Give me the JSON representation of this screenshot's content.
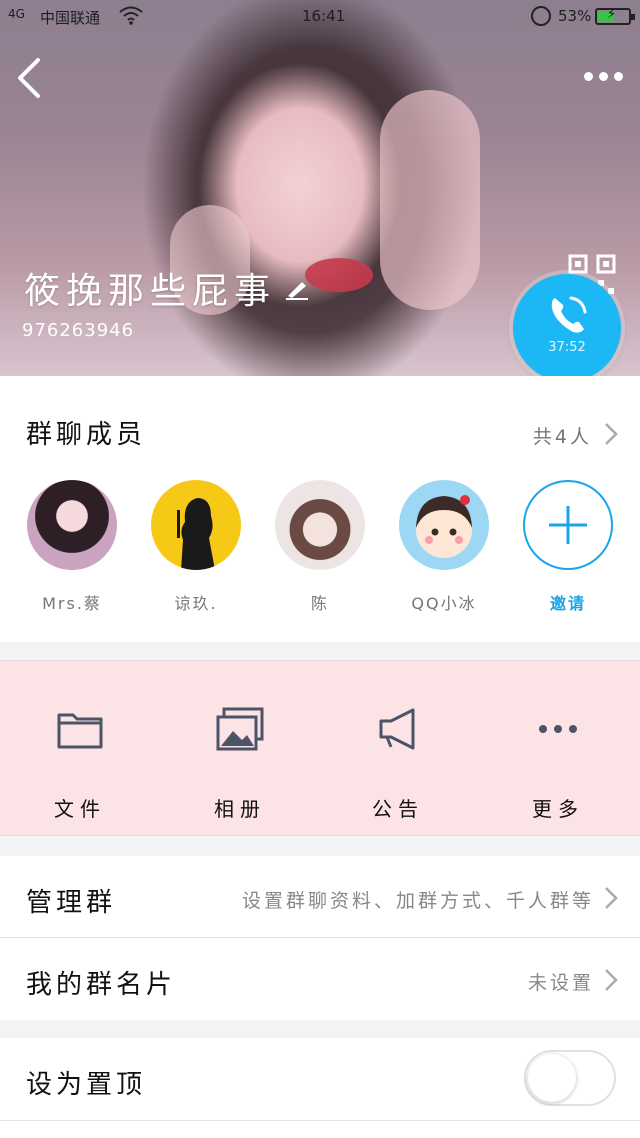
{
  "status_bar": {
    "signal": "4G",
    "carrier": "中国联通",
    "time": "16:41",
    "battery_percent": "53%",
    "battery_level": 0.53
  },
  "header": {
    "group_name": "筱挽那些屁事",
    "group_id": "976263946",
    "call_timer": "37:52"
  },
  "members": {
    "title": "群聊成员",
    "count": "共4人",
    "list": [
      {
        "name": "Mrs.蔡"
      },
      {
        "name": "谅玖."
      },
      {
        "name": "陈"
      },
      {
        "name": "QQ小冰"
      }
    ],
    "invite_label": "邀请"
  },
  "actions": [
    {
      "label": "文件",
      "icon": "folder-icon"
    },
    {
      "label": "相册",
      "icon": "album-icon"
    },
    {
      "label": "公告",
      "icon": "megaphone-icon"
    },
    {
      "label": "更多",
      "icon": "more-icon"
    }
  ],
  "settings": {
    "manage": {
      "label": "管理群",
      "value": "设置群聊资料、加群方式、千人群等"
    },
    "card": {
      "label": "我的群名片",
      "value": "未设置"
    },
    "pin": {
      "label": "设为置顶",
      "enabled": false
    }
  },
  "colors": {
    "accent": "#19a6e8",
    "call_bubble": "#1bb8f5",
    "actions_bg": "#fce4e6"
  }
}
